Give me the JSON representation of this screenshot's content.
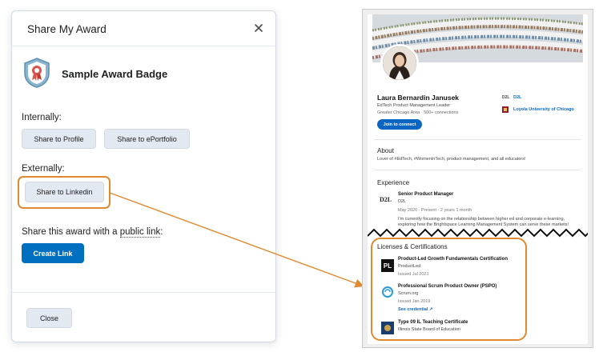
{
  "dialog": {
    "title": "Share My Award",
    "award_name": "Sample Award Badge",
    "internally_label": "Internally:",
    "share_profile_label": "Share to Profile",
    "share_eportfolio_label": "Share to ePortfolio",
    "externally_label": "Externally:",
    "share_linkedin_label": "Share to Linkedin",
    "public_link_prefix": "Share this award with a ",
    "public_link_word": "public link",
    "public_link_suffix": ":",
    "create_link_label": "Create Link",
    "close_label": "Close"
  },
  "linkedin": {
    "name": "Laura Bernardin Janusek",
    "headline": "EdTech Product Management Leader",
    "location": "Greater Chicago Area · 500+ connections",
    "join_label": "Join to connect",
    "company_logo": "D2L",
    "company": "D2L",
    "school": "Loyola University of Chicago",
    "about_heading": "About",
    "about_text": "Lover of #EdTech, #WomenInTech, product management, and all educators!",
    "experience_heading": "Experience",
    "job_title": "Senior Product Manager",
    "job_company": "D2L",
    "job_dates": "May 2020 - Present · 2 years 1 month",
    "job_desc_1": "I'm currently focusing on the relationship between higher ed and corporate e-learning,",
    "job_desc_2": "exploring how the Brightspace Learning Management System can serve these markets!",
    "certs_heading": "Licenses & Certifications",
    "certs": [
      {
        "title": "Product-Led Growth Fundamentals Certification",
        "issuer": "ProductLed",
        "issued": "Issued Jul 2021",
        "logo": "PL"
      },
      {
        "title": "Professional Scrum Product Owner (PSPO)",
        "issuer": "Scrum.org",
        "issued": "Issued Jan 2019",
        "credential": "See credential"
      },
      {
        "title": "Type 09 IL Teaching Certificate",
        "issuer": "Illinois State Board of Education"
      }
    ]
  },
  "colors": {
    "primary": "#006fbf",
    "highlight": "#e0892f",
    "linkedin_blue": "#0a66c2"
  }
}
